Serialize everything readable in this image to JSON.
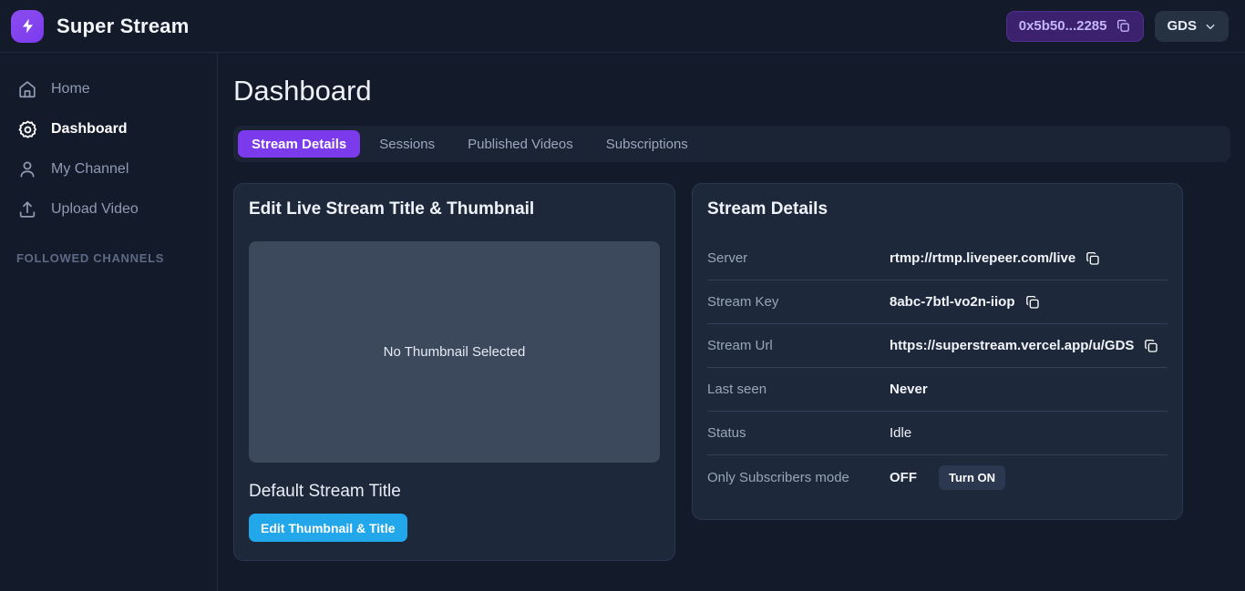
{
  "topbar": {
    "brand_name": "Super Stream",
    "logo_icon": "lightning-bolt-icon",
    "wallet_address": "0x5b50...2285",
    "wallet_copy_icon": "copy-icon",
    "account_name": "GDS",
    "account_chevron_icon": "chevron-down-icon",
    "accent_purple": "#7c3aed",
    "wallet_chip_bg": "#3b216e"
  },
  "sidebar": {
    "items": [
      {
        "label": "Home",
        "icon": "home-icon",
        "active": false
      },
      {
        "label": "Dashboard",
        "icon": "gear-icon",
        "active": true
      },
      {
        "label": "My Channel",
        "icon": "user-icon",
        "active": false
      },
      {
        "label": "Upload Video",
        "icon": "upload-icon",
        "active": false
      }
    ],
    "section_label": "FOLLOWED CHANNELS"
  },
  "main": {
    "page_title": "Dashboard",
    "tabs": [
      {
        "label": "Stream Details",
        "active": true
      },
      {
        "label": "Sessions",
        "active": false
      },
      {
        "label": "Published Videos",
        "active": false
      },
      {
        "label": "Subscriptions",
        "active": false
      }
    ]
  },
  "thumbnail_card": {
    "title": "Edit Live Stream Title & Thumbnail",
    "placeholder_text": "No Thumbnail Selected",
    "stream_title": "Default Stream Title",
    "edit_button_label": "Edit Thumbnail & Title",
    "edit_button_color": "#22a7eb"
  },
  "stream_details_card": {
    "title": "Stream Details",
    "rows": [
      {
        "label": "Server",
        "value": "rtmp://rtmp.livepeer.com/live",
        "copy": true,
        "bold": true
      },
      {
        "label": "Stream Key",
        "value": "8abc-7btl-vo2n-iiop",
        "copy": true,
        "bold": true
      },
      {
        "label": "Stream Url",
        "value": "https://superstream.vercel.app/u/GDS",
        "copy": true,
        "bold": true
      },
      {
        "label": "Last seen",
        "value": "Never",
        "copy": false,
        "bold": true
      },
      {
        "label": "Status",
        "value": "Idle",
        "copy": false,
        "bold": false
      }
    ],
    "subscribers_row": {
      "label": "Only Subscribers mode",
      "state": "OFF",
      "toggle_button_label": "Turn ON"
    },
    "copy_icon": "copy-icon"
  }
}
